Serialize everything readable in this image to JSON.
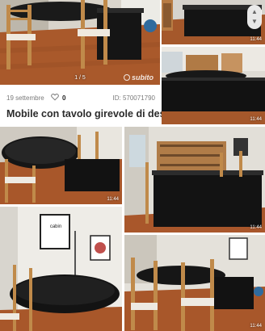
{
  "listing": {
    "date": "19 settembre",
    "likes": "0",
    "id_label": "ID: 570071790",
    "title": "Mobile con tavolo girevole di design"
  },
  "gallery": {
    "counter": "1 / 5",
    "watermark": "subito"
  },
  "thumbnails": [
    {
      "timestamp": "11:44"
    },
    {
      "timestamp": "11:44"
    },
    {
      "timestamp": "11:44"
    },
    {
      "timestamp": "11:44"
    },
    {
      "timestamp": "11:44"
    }
  ],
  "poster_text": "cabin",
  "icons": {
    "heart": "heart-outline-icon",
    "scroll_up": "chevron-up-icon",
    "scroll_down": "chevron-down-icon"
  },
  "colors": {
    "floor": "#a8582a",
    "cabinet": "#151515",
    "wall": "#e8e6e1",
    "title": "#2b2b2b",
    "meta": "#7a7a7a"
  }
}
